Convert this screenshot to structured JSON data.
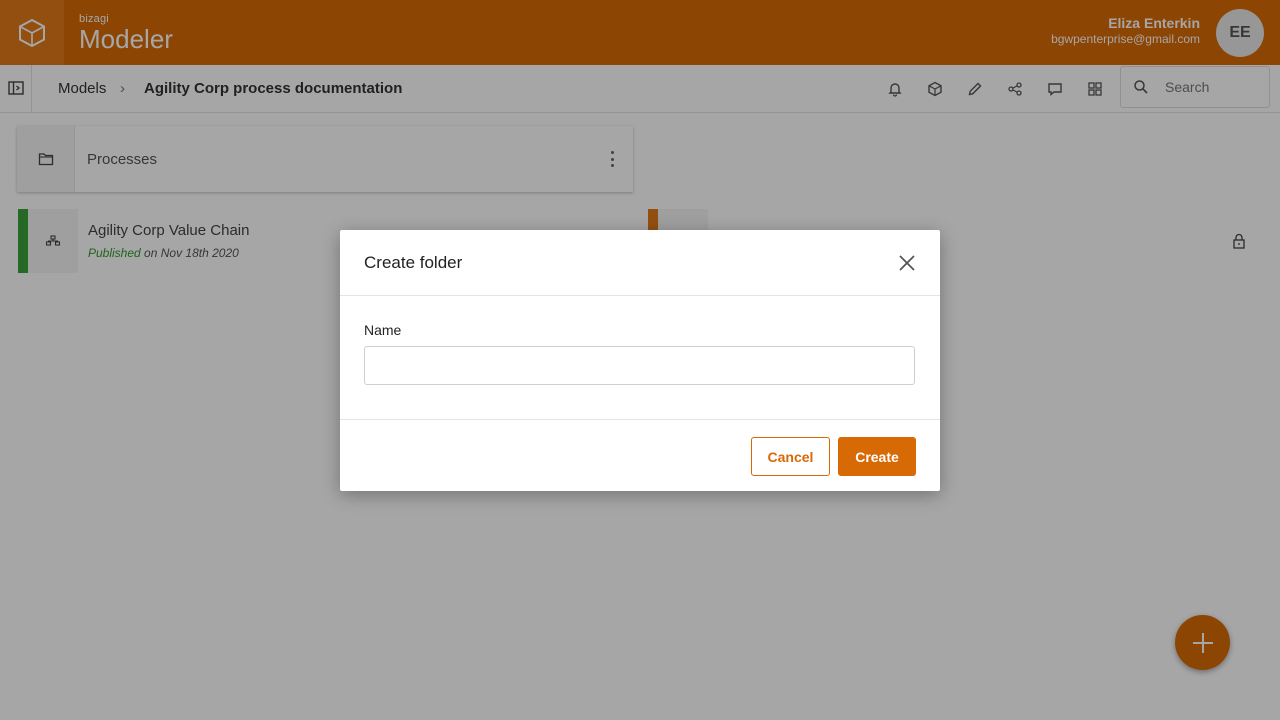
{
  "colors": {
    "brand": "#d86a06",
    "published": "#3aa13a"
  },
  "app": {
    "brand_small": "bizagi",
    "brand_name": "Modeler"
  },
  "user": {
    "name": "Eliza Enterkin",
    "email": "bgwpenterprise@gmail.com",
    "initials": "EE"
  },
  "breadcrumb": {
    "root": "Models",
    "separator": "›",
    "current": "Agility Corp process documentation"
  },
  "toolbar": {
    "icons": [
      "bell-icon",
      "cube-icon",
      "pencil-icon",
      "share-icon",
      "comment-icon",
      "grid-icon"
    ],
    "search_placeholder": "Search"
  },
  "folders": [
    {
      "name": "Processes",
      "icon": "folder-icon"
    }
  ],
  "models": [
    {
      "name": "Agility Corp Value Chain",
      "status": "Published",
      "date_text": " on Nov 18th 2020"
    }
  ],
  "dialog": {
    "title": "Create folder",
    "field_label": "Name",
    "field_value": "",
    "cancel_label": "Cancel",
    "create_label": "Create"
  }
}
